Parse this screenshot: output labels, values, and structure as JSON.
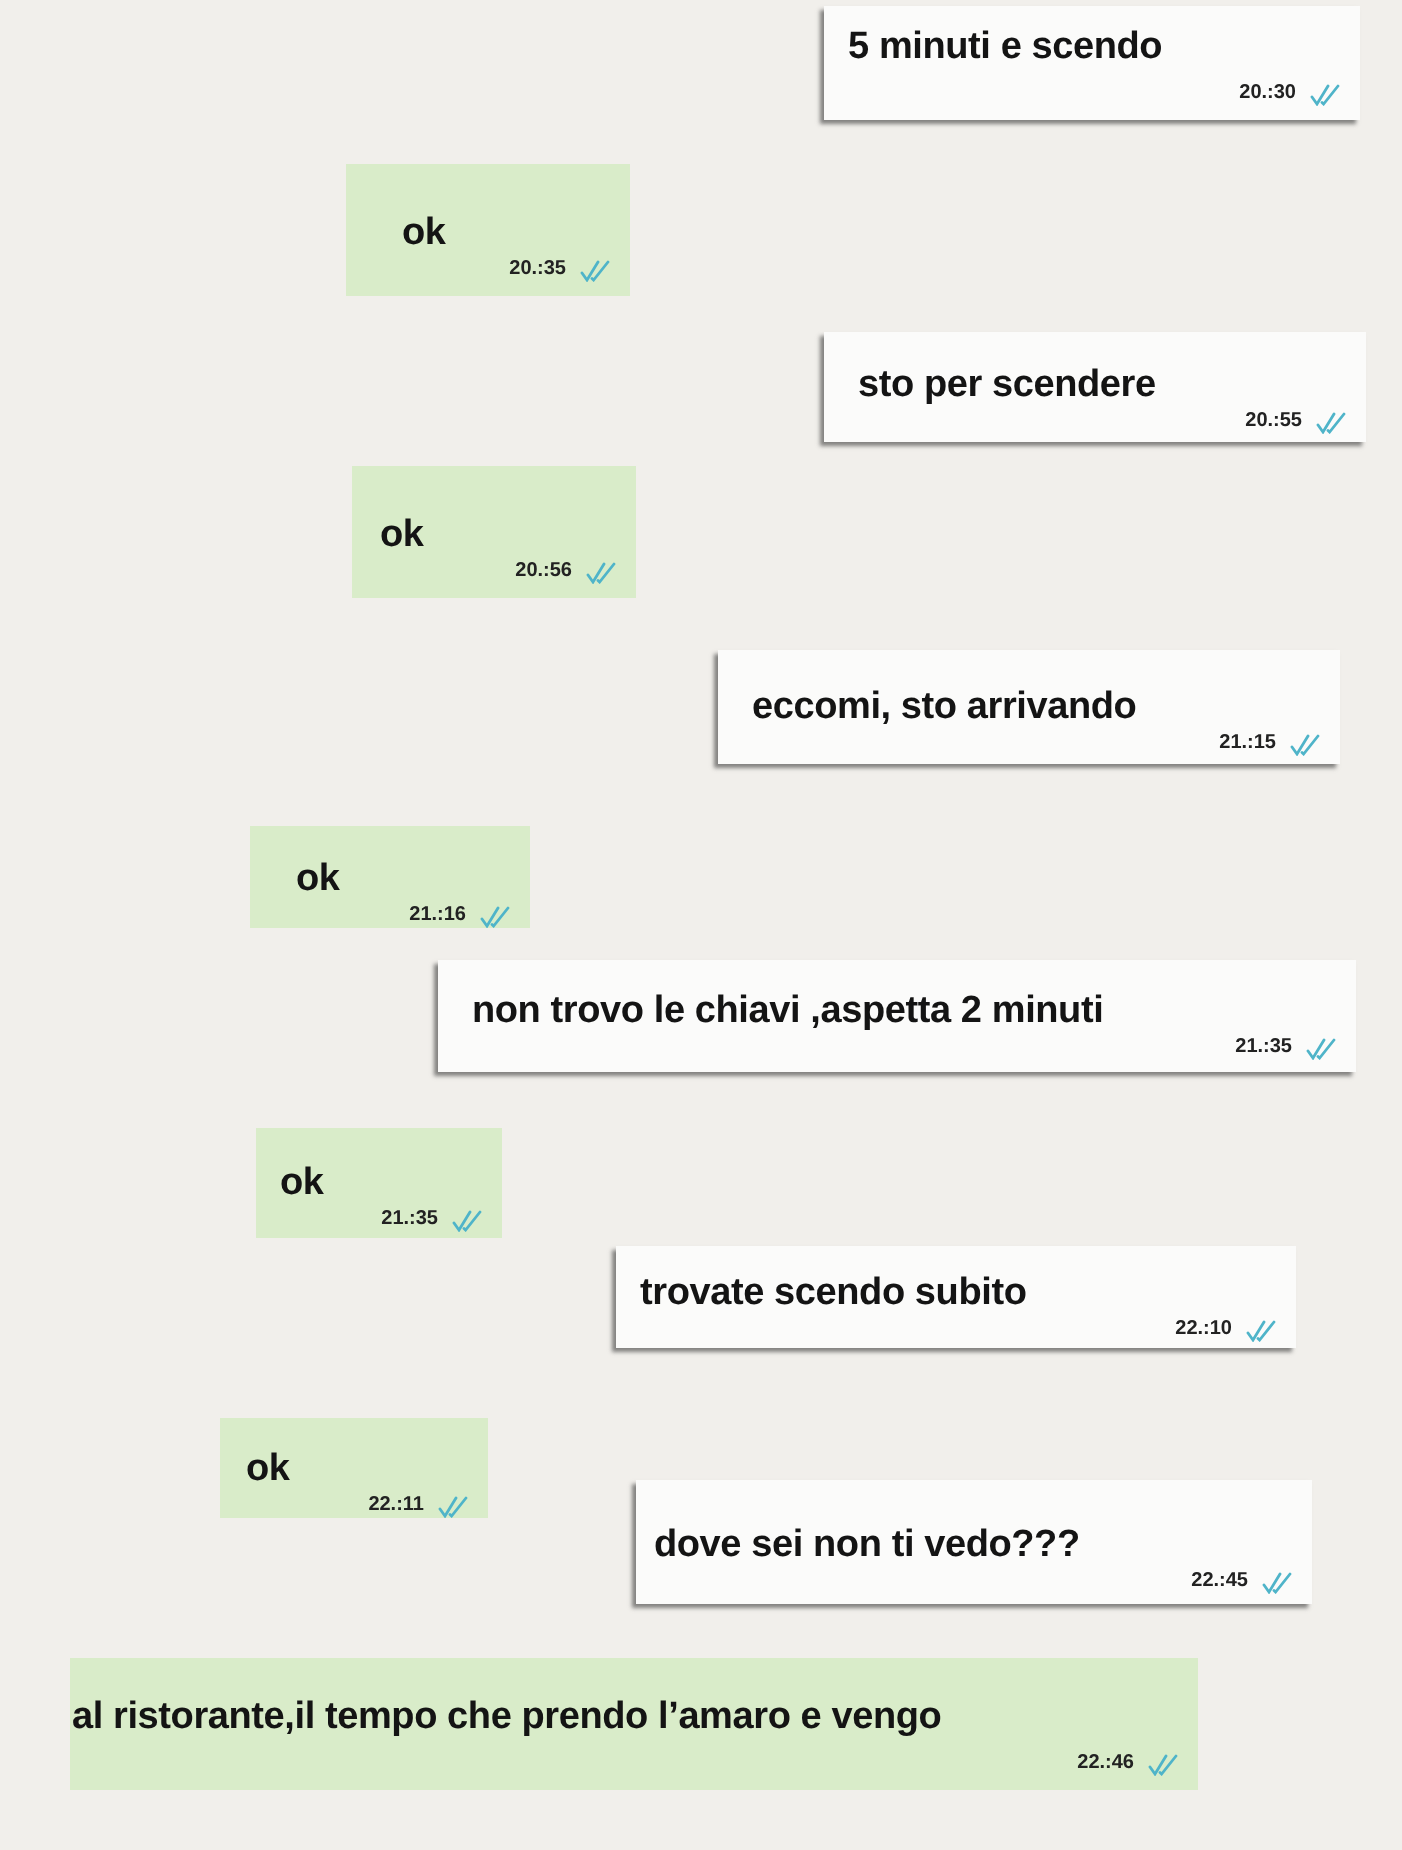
{
  "messages": [
    {
      "kind": "incoming",
      "text": "5 minuti e scendo",
      "time": "20.:30"
    },
    {
      "kind": "outgoing",
      "text": "ok",
      "time": "20.:35"
    },
    {
      "kind": "incoming",
      "text": "sto per scendere",
      "time": "20.:55"
    },
    {
      "kind": "outgoing",
      "text": "ok",
      "time": "20.:56"
    },
    {
      "kind": "incoming",
      "text": "eccomi, sto arrivando",
      "time": "21.:15"
    },
    {
      "kind": "outgoing",
      "text": "ok",
      "time": "21.:16"
    },
    {
      "kind": "incoming",
      "text": "non trovo le chiavi ,aspetta 2 minuti",
      "time": "21.:35"
    },
    {
      "kind": "outgoing",
      "text": "ok",
      "time": "21.:35"
    },
    {
      "kind": "incoming",
      "text": "trovate scendo subito",
      "time": "22.:10"
    },
    {
      "kind": "outgoing",
      "text": "ok",
      "time": "22.:11"
    },
    {
      "kind": "incoming",
      "text": "dove sei non ti vedo???",
      "time": "22.:45"
    },
    {
      "kind": "outgoing",
      "text": "al ristorante,il tempo che prendo l’amaro e vengo",
      "time": "22.:46"
    }
  ]
}
